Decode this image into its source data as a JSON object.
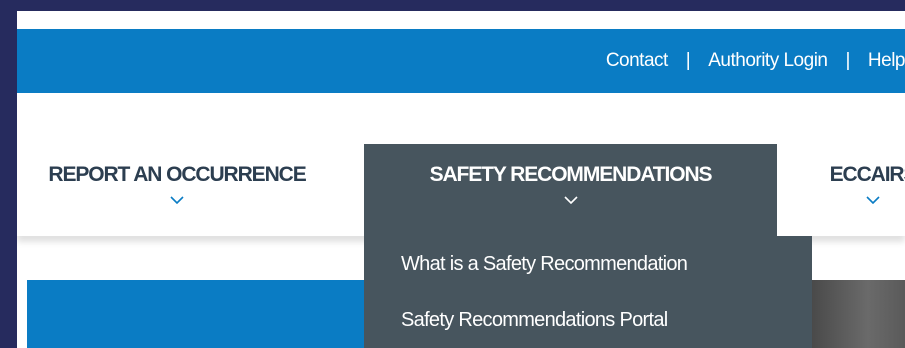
{
  "topbar": {
    "links": [
      "Contact",
      "Authority Login",
      "Help"
    ],
    "separator": "|"
  },
  "nav": {
    "items": [
      {
        "label": "REPORT AN OCCURRENCE"
      },
      {
        "label": "SAFETY RECOMMENDATIONS",
        "active": true
      },
      {
        "label": "ECCAIRS"
      }
    ]
  },
  "dropdown": {
    "items": [
      "What is a Safety Recommendation",
      "Safety Recommendations Portal"
    ]
  },
  "colors": {
    "background": "#262b5e",
    "brand_blue": "#0a7cc4",
    "nav_active": "#47555e",
    "nav_text": "#2c3e50"
  },
  "icons": {
    "nav_chevron": "chevron-down-icon"
  }
}
